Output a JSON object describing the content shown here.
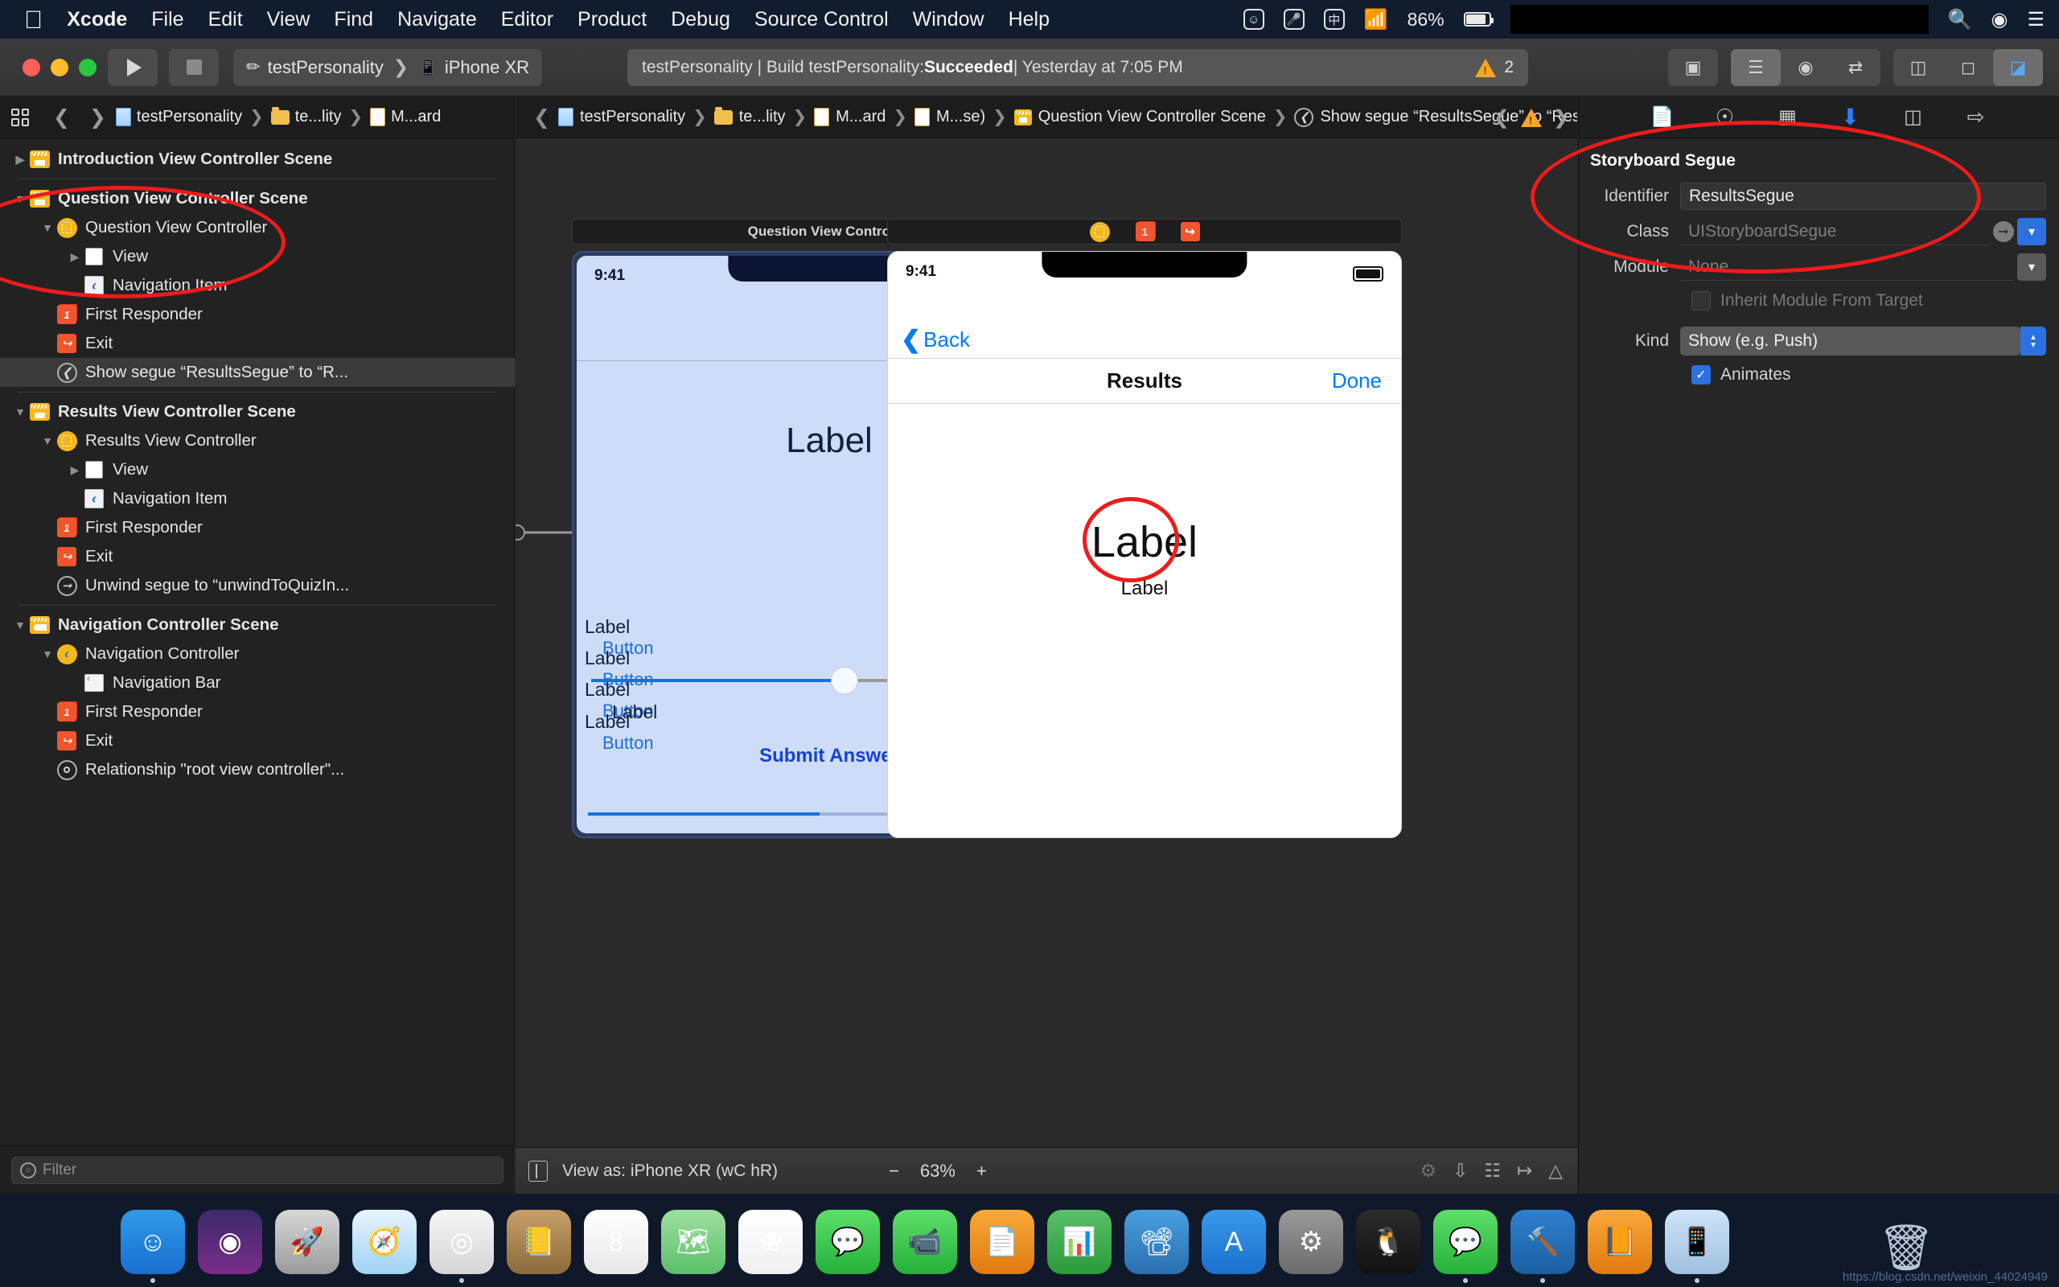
{
  "menubar": {
    "apple_icon": "apple-logo-icon",
    "items": [
      "Xcode",
      "File",
      "Edit",
      "View",
      "Find",
      "Navigate",
      "Editor",
      "Product",
      "Debug",
      "Source Control",
      "Window",
      "Help"
    ],
    "status_icons": [
      "emoji-face-icon",
      "microphone-icon",
      "input-source-icon",
      "wifi-icon"
    ],
    "battery_percent": "86%",
    "right_icons": [
      "search-icon",
      "siri-icon",
      "control-center-icon"
    ]
  },
  "toolbar": {
    "run_label": "run-button",
    "stop_label": "stop-button",
    "scheme": "testPersonality",
    "destination": "iPhone XR",
    "status_text_plain": "testPersonality | Build testPersonality: ",
    "status_text_bold": "Succeeded",
    "status_text_time": " | Yesterday at 7:05 PM",
    "warning_count": "2"
  },
  "navigator": {
    "breadcrumbs": [
      {
        "label": "testPersonality",
        "icon": "project-file-icon"
      },
      {
        "label": "te...lity",
        "icon": "folder-icon"
      },
      {
        "label": "M...ard",
        "icon": "storyboard-file-icon"
      }
    ],
    "tree": [
      {
        "label": "Introduction View Controller Scene",
        "icon": "scene-icon",
        "indent": 0,
        "disclosure": "collapsed",
        "bold": true,
        "selected": false
      },
      {
        "divider": true
      },
      {
        "label": "Question View Controller Scene",
        "icon": "scene-icon",
        "indent": 0,
        "disclosure": "expanded",
        "bold": true,
        "selected": false
      },
      {
        "label": "Question View Controller",
        "icon": "view-controller-icon",
        "indent": 1,
        "disclosure": "expanded",
        "bold": false,
        "selected": false
      },
      {
        "label": "View",
        "icon": "view-icon",
        "indent": 2,
        "disclosure": "collapsed",
        "bold": false,
        "selected": false
      },
      {
        "label": "Navigation Item",
        "icon": "navigation-item-icon",
        "indent": 2,
        "disclosure": "none",
        "bold": false,
        "selected": false
      },
      {
        "label": "First Responder",
        "icon": "first-responder-icon",
        "indent": 1,
        "disclosure": "none",
        "bold": false,
        "selected": false
      },
      {
        "label": "Exit",
        "icon": "exit-icon",
        "indent": 1,
        "disclosure": "none",
        "bold": false,
        "selected": false
      },
      {
        "label": "Show segue “ResultsSegue” to “R...",
        "icon": "segue-icon",
        "indent": 1,
        "disclosure": "none",
        "bold": false,
        "selected": true
      },
      {
        "divider": true
      },
      {
        "label": "Results View Controller Scene",
        "icon": "scene-icon",
        "indent": 0,
        "disclosure": "expanded",
        "bold": true,
        "selected": false
      },
      {
        "label": "Results View Controller",
        "icon": "view-controller-icon",
        "indent": 1,
        "disclosure": "expanded",
        "bold": false,
        "selected": false
      },
      {
        "label": "View",
        "icon": "view-icon",
        "indent": 2,
        "disclosure": "collapsed",
        "bold": false,
        "selected": false
      },
      {
        "label": "Navigation Item",
        "icon": "navigation-item-icon",
        "indent": 2,
        "disclosure": "none",
        "bold": false,
        "selected": false
      },
      {
        "label": "First Responder",
        "icon": "first-responder-icon",
        "indent": 1,
        "disclosure": "none",
        "bold": false,
        "selected": false
      },
      {
        "label": "Exit",
        "icon": "exit-icon",
        "indent": 1,
        "disclosure": "none",
        "bold": false,
        "selected": false
      },
      {
        "label": "Unwind segue to “unwindToQuizIn...",
        "icon": "unwind-segue-icon",
        "indent": 1,
        "disclosure": "none",
        "bold": false,
        "selected": false
      },
      {
        "divider": true
      },
      {
        "label": "Navigation Controller Scene",
        "icon": "nav-scene-icon",
        "indent": 0,
        "disclosure": "expanded",
        "bold": true,
        "selected": false
      },
      {
        "label": "Navigation Controller",
        "icon": "navigation-controller-icon",
        "indent": 1,
        "disclosure": "expanded",
        "bold": false,
        "selected": false
      },
      {
        "label": "Navigation Bar",
        "icon": "navigation-bar-icon",
        "indent": 2,
        "disclosure": "none",
        "bold": false,
        "selected": false
      },
      {
        "label": "First Responder",
        "icon": "first-responder-icon",
        "indent": 1,
        "disclosure": "none",
        "bold": false,
        "selected": false
      },
      {
        "label": "Exit",
        "icon": "exit-icon",
        "indent": 1,
        "disclosure": "none",
        "bold": false,
        "selected": false
      },
      {
        "label": "Relationship \"root view controller\"...",
        "icon": "relationship-icon",
        "indent": 1,
        "disclosure": "none",
        "bold": false,
        "selected": false
      }
    ],
    "filter_placeholder": "Filter"
  },
  "editor": {
    "breadcrumbs": [
      {
        "label": "testPersonality",
        "icon": "project-file-icon"
      },
      {
        "label": "te...lity",
        "icon": "folder-icon"
      },
      {
        "label": "M...ard",
        "icon": "storyboard-file-icon"
      },
      {
        "label": "M...se)",
        "icon": "storyboard-file-icon"
      },
      {
        "label": "Question View Controller Scene",
        "icon": "scene-icon"
      },
      {
        "label": "Show segue “ResultsSegue” to “Results View Controller”",
        "icon": "segue-icon"
      }
    ],
    "warning_badge": "warning-triangle-icon"
  },
  "canvas": {
    "left_scene": {
      "title": "Question View Controller",
      "status_time": "9:41",
      "big_label": "Label",
      "rows": [
        {
          "label": "Label",
          "button": "Button"
        },
        {
          "label": "Label",
          "button": "Button"
        },
        {
          "label": "Label",
          "button": "Button"
        },
        {
          "label": "Label",
          "button": "Button"
        }
      ],
      "mid_label": "Label",
      "right_label": "Label",
      "submit": "Submit Answer"
    },
    "right_scene": {
      "dock_icons": [
        "view-controller-icon",
        "first-responder-icon",
        "exit-icon"
      ],
      "status_time": "9:41",
      "back": "Back",
      "title": "Results",
      "done": "Done",
      "big_label": "Label",
      "sub_label": "Label"
    }
  },
  "bottombar": {
    "view_as": "View as: iPhone XR (wC hR)",
    "zoom_out": "−",
    "zoom_level": "63%",
    "zoom_in": "+"
  },
  "inspector": {
    "tabs": [
      "file-inspector-icon",
      "quick-help-icon",
      "identity-inspector-icon",
      "attributes-inspector-icon",
      "size-inspector-icon",
      "connections-inspector-icon"
    ],
    "active_tab_index": 3,
    "section_title": "Storyboard Segue",
    "fields": {
      "identifier_label": "Identifier",
      "identifier_value": "ResultsSegue",
      "class_label": "Class",
      "class_value": "UIStoryboardSegue",
      "module_label": "Module",
      "module_value": "None",
      "inherit_label": "Inherit Module From Target",
      "inherit_checked": false,
      "kind_label": "Kind",
      "kind_value": "Show (e.g. Push)",
      "animates_label": "Animates",
      "animates_checked": true
    }
  },
  "dock": {
    "apps": [
      {
        "name": "finder",
        "glyph": "☺",
        "color1": "#2f9ae8",
        "color2": "#1a6fd0",
        "running": true
      },
      {
        "name": "siri",
        "glyph": "◉",
        "color1": "#3a2a6a",
        "color2": "#7b2c8a",
        "running": false
      },
      {
        "name": "launchpad",
        "glyph": "🚀",
        "color1": "#d8d8d8",
        "color2": "#9a9a9a",
        "running": false
      },
      {
        "name": "safari",
        "glyph": "🧭",
        "color1": "#e8f4ff",
        "color2": "#9fd3f5",
        "running": false
      },
      {
        "name": "chrome",
        "glyph": "◎",
        "color1": "#f5f5f5",
        "color2": "#d6d6d6",
        "running": true
      },
      {
        "name": "contacts",
        "glyph": "📒",
        "color1": "#c9a06a",
        "color2": "#8a6a3a",
        "running": false
      },
      {
        "name": "calendar",
        "glyph": "8",
        "color1": "#ffffff",
        "color2": "#e8e8e8",
        "running": false
      },
      {
        "name": "maps",
        "glyph": "🗺",
        "color1": "#9fe0a0",
        "color2": "#5bbf6a",
        "running": false
      },
      {
        "name": "photos",
        "glyph": "❀",
        "color1": "#ffffff",
        "color2": "#f0f0f0",
        "running": false
      },
      {
        "name": "messages",
        "glyph": "💬",
        "color1": "#5de06a",
        "color2": "#25b03a",
        "running": false
      },
      {
        "name": "facetime",
        "glyph": "📹",
        "color1": "#5de06a",
        "color2": "#25b03a",
        "running": false
      },
      {
        "name": "pages",
        "glyph": "📄",
        "color1": "#f8a93a",
        "color2": "#e07a10",
        "running": false
      },
      {
        "name": "numbers",
        "glyph": "📊",
        "color1": "#5bbf6a",
        "color2": "#2a9a3a",
        "running": false
      },
      {
        "name": "keynote",
        "glyph": "📽",
        "color1": "#4a9fe0",
        "color2": "#2a6fb0",
        "running": false
      },
      {
        "name": "appstore",
        "glyph": "A",
        "color1": "#3a9ae8",
        "color2": "#1a6fd0",
        "running": false
      },
      {
        "name": "settings",
        "glyph": "⚙",
        "color1": "#9a9a9a",
        "color2": "#6a6a6a",
        "running": false
      },
      {
        "name": "qq",
        "glyph": "🐧",
        "color1": "#2b2b2b",
        "color2": "#111111",
        "running": false
      },
      {
        "name": "wechat",
        "glyph": "💬",
        "color1": "#5de06a",
        "color2": "#25b03a",
        "running": true
      },
      {
        "name": "xcode",
        "glyph": "🔨",
        "color1": "#2f7fd0",
        "color2": "#1a5fa0",
        "running": true
      },
      {
        "name": "books",
        "glyph": "📙",
        "color1": "#f8a93a",
        "color2": "#e07a10",
        "running": false
      },
      {
        "name": "simulator",
        "glyph": "📱",
        "color1": "#cfe4f8",
        "color2": "#9fc0e0",
        "running": true
      }
    ],
    "trash": "trash-icon",
    "watermark": "https://blog.csdn.net/weixin_44024949"
  }
}
